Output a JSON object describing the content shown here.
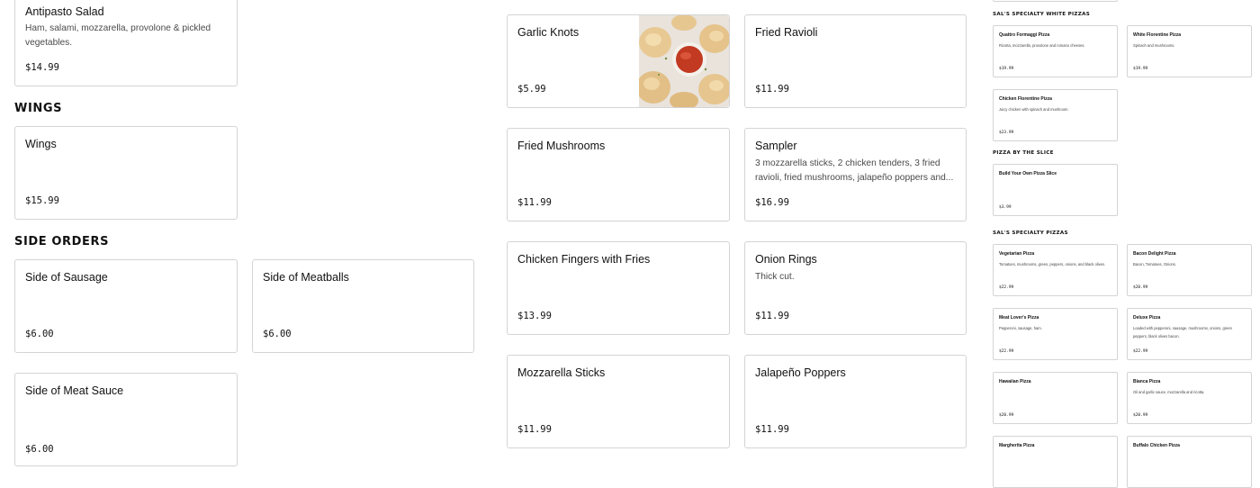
{
  "sections": {
    "wings": "WINGS",
    "side_orders": "SIDE ORDERS"
  },
  "items": {
    "antipasto": {
      "name": "Antipasto Salad",
      "desc": "Ham, salami, mozzarella, provolone & pickled vegetables.",
      "price": "$14.99"
    },
    "wings": {
      "name": "Wings",
      "price": "$15.99"
    },
    "side_sausage": {
      "name": "Side of Sausage",
      "price": "$6.00"
    },
    "side_meatballs": {
      "name": "Side of Meatballs",
      "price": "$6.00"
    },
    "side_meat_sauce": {
      "name": "Side of Meat Sauce",
      "price": "$6.00"
    },
    "garlic_knots": {
      "name": "Garlic Knots",
      "price": "$5.99",
      "image": "garlic-knots-photo"
    },
    "fried_ravioli": {
      "name": "Fried Ravioli",
      "price": "$11.99"
    },
    "fried_mushrooms": {
      "name": "Fried Mushrooms",
      "price": "$11.99"
    },
    "sampler": {
      "name": "Sampler",
      "desc": "3 mozzarella sticks, 2 chicken tenders, 3 fried ravioli, fried mushrooms, jalapeño poppers and...",
      "price": "$16.99"
    },
    "chicken_fingers": {
      "name": "Chicken Fingers with Fries",
      "price": "$13.99"
    },
    "onion_rings": {
      "name": "Onion Rings",
      "desc": "Thick cut.",
      "price": "$11.99"
    },
    "mozzarella_sticks": {
      "name": "Mozzarella Sticks",
      "price": "$11.99"
    },
    "jalapeno_poppers": {
      "name": "Jalapeño Poppers",
      "price": "$11.99"
    }
  },
  "right_column": {
    "white_title": "SAL'S SPECIALTY WHITE PIZZAS",
    "by_slice_title": "PIZZA BY THE SLICE",
    "specialty_title": "SAL'S SPECIALTY PIZZAS",
    "quattro": {
      "name": "Quattro Formaggi Pizza",
      "desc": "Ricotta, mozzarella, provolone and romano cheeses.",
      "price": "$19.99"
    },
    "white_florentine": {
      "name": "White Florentine Pizza",
      "desc": "Spinach and mushrooms.",
      "price": "$19.99"
    },
    "chicken_florentine": {
      "name": "Chicken Florentine Pizza",
      "desc": "Juicy chicken with spinach and mushroom.",
      "price": "$23.99"
    },
    "byo_slice": {
      "name": "Build Your Own Pizza Slice",
      "desc": "",
      "price": "$3.99"
    },
    "vegetarian": {
      "name": "Vegetarian Pizza",
      "desc": "Tomatoes, mushrooms, green, peppers, onions, and black olives.",
      "price": "$22.99"
    },
    "bacon_delight": {
      "name": "Bacon Delight Pizza",
      "desc": "Bacon, Tomatoes, Onions.",
      "price": "$20.99"
    },
    "meat_lovers": {
      "name": "Meat Lover's Pizza",
      "desc": "Pepperoni, sausage, ham.",
      "price": "$22.99"
    },
    "deluxe": {
      "name": "Deluxe Pizza",
      "desc": "Loaded with pepperoni, sausage, mushrooms, onions, green peppers, black olives bacon.",
      "price": "$22.99"
    },
    "hawaiian": {
      "name": "Hawaiian Pizza",
      "desc": "",
      "price": "$20.99"
    },
    "bianca": {
      "name": "Bianca Pizza",
      "desc": "Oil and garlic sauce, mozzarella and ricotta.",
      "price": "$20.99"
    },
    "margherita": {
      "name": "Margherita Pizza",
      "desc": "",
      "price": ""
    },
    "buffalo_chicken": {
      "name": "Buffalo Chicken Pizza",
      "desc": "",
      "price": ""
    }
  }
}
